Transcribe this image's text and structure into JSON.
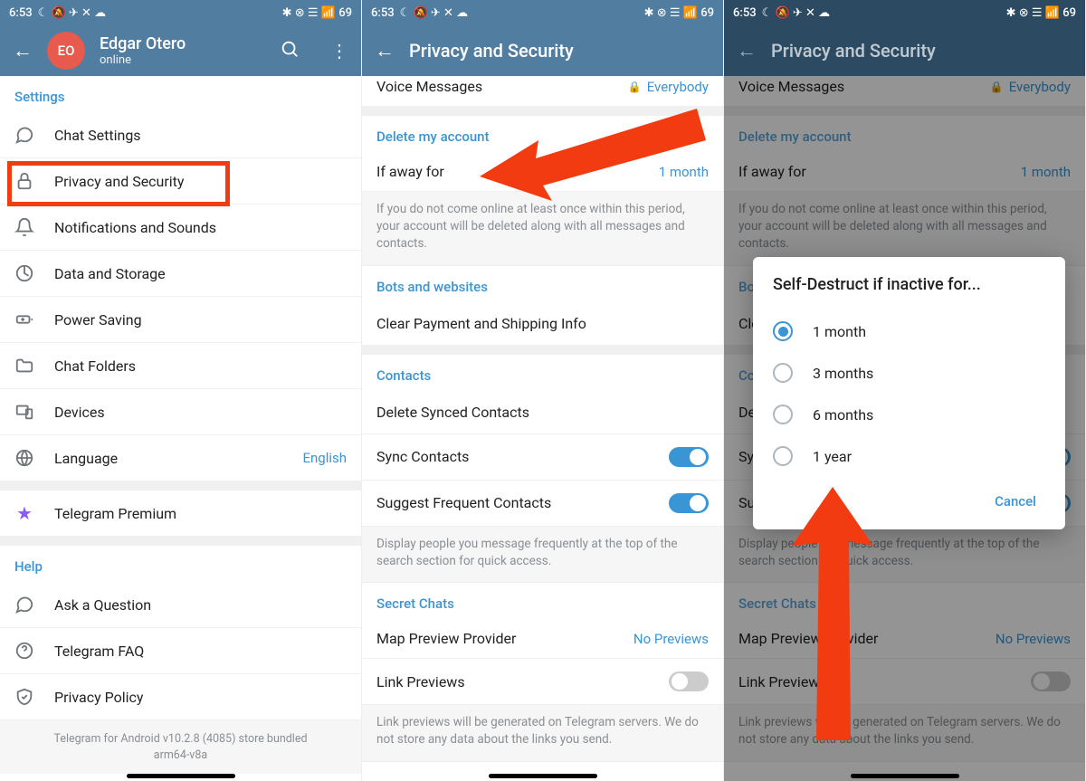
{
  "status": {
    "time": "6:53",
    "icons_left": "☾ 🔕 ✈ ✕ ☁",
    "icons_right": "✱ ⊗ ☰ 📶 69"
  },
  "p1": {
    "name": "Edgar Otero",
    "initials": "EO",
    "sub": "online",
    "settings_head": "Settings",
    "help_head": "Help",
    "items": {
      "chat": "Chat Settings",
      "privacy": "Privacy and Security",
      "notif": "Notifications and Sounds",
      "data": "Data and Storage",
      "power": "Power Saving",
      "folders": "Chat Folders",
      "devices": "Devices",
      "language": "Language",
      "language_val": "English",
      "premium": "Telegram Premium",
      "ask": "Ask a Question",
      "faq": "Telegram FAQ",
      "policy": "Privacy Policy"
    },
    "footer1": "Telegram for Android v10.2.8 (4085) store bundled",
    "footer2": "arm64-v8a"
  },
  "p2": {
    "title": "Privacy and Security",
    "voice_label": "Voice Messages",
    "voice_val": "Everybody",
    "delete_head": "Delete my account",
    "away_label": "If away for",
    "away_val": "1 month",
    "away_hint": "If you do not come online at least once within this period, your account will be deleted along with all messages and contacts.",
    "bots_head": "Bots and websites",
    "clear_pay": "Clear Payment and Shipping Info",
    "contacts_head": "Contacts",
    "del_sync": "Delete Synced Contacts",
    "sync": "Sync Contacts",
    "suggest": "Suggest Frequent Contacts",
    "suggest_hint": "Display people you message frequently at the top of the search section for quick access.",
    "secret_head": "Secret Chats",
    "map_label": "Map Preview Provider",
    "map_val": "No Previews",
    "link_label": "Link Previews",
    "link_hint": "Link previews will be generated on Telegram servers. We do not store any data about the links you send."
  },
  "dialog": {
    "title": "Self-Destruct if inactive for...",
    "o1": "1 month",
    "o2": "3 months",
    "o3": "6 months",
    "o4": "1 year",
    "cancel": "Cancel"
  }
}
